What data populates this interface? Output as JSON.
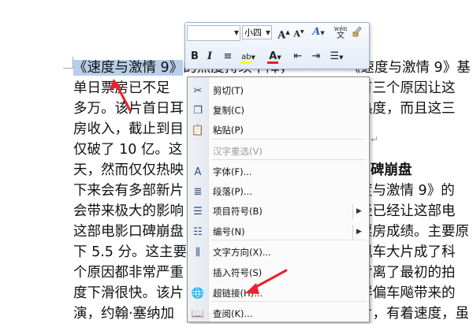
{
  "document": {
    "lines": [
      {
        "pre": "",
        "selected": "《速度与激情 9》",
        "post": "的热度持续下降，",
        "right": "《速度与激情 9》基"
      },
      {
        "pre": "单日票房已不足",
        "right": "有三个原因让这"
      },
      {
        "pre": "多万。该片首日耳",
        "right": "热度，而且这三"
      },
      {
        "pre": "房收入，截止到目",
        "right": ""
      },
      {
        "pre": "仅破了 10 亿。这",
        "right": ""
      },
      {
        "pre": "天，然而仅仅热映",
        "right": "碑崩盘"
      },
      {
        "pre": "下来会有多部新片",
        "right": "度与激情 9》的"
      },
      {
        "pre": "会带来极大的影响",
        "right": "经已经让这部电"
      },
      {
        "pre": "这部电影口碑崩盘",
        "right": "票房成绩。主要原"
      },
      {
        "pre": "下 5.5 分。这主要",
        "right": "飙车大片成了科"
      },
      {
        "pre": "个原因都非常严重",
        "right": "背离了最初的拍"
      },
      {
        "pre": "度下滑很快。该片",
        "right": "群偏车飚带来的"
      },
      {
        "pre": "演，约翰·塞纳加",
        "right": "片，有着速度，虽"
      }
    ]
  },
  "mini_toolbar": {
    "font_name": "",
    "font_size": "小四",
    "buttons": {
      "grow_font": "A",
      "shrink_font": "A",
      "format_painter_text": "A",
      "phonetic": "wén",
      "bold": "B",
      "italic": "I",
      "font_color": "A"
    }
  },
  "context_menu": {
    "items": [
      {
        "label": "剪切(T)",
        "icon": "scissors-icon",
        "glyph": "✂",
        "enabled": true
      },
      {
        "label": "复制(C)",
        "icon": "copy-icon",
        "glyph": "❐",
        "enabled": true
      },
      {
        "label": "粘贴(P)",
        "icon": "paste-icon",
        "glyph": "📋",
        "enabled": true
      },
      {
        "label": "汉字重选(V)",
        "icon": "",
        "glyph": "",
        "enabled": false
      },
      {
        "label": "字体(F)...",
        "icon": "font-icon",
        "glyph": "A",
        "enabled": true
      },
      {
        "label": "段落(P)...",
        "icon": "paragraph-icon",
        "glyph": "≣",
        "enabled": true
      },
      {
        "label": "项目符号(B)",
        "icon": "bullets-icon",
        "glyph": "☰",
        "enabled": true,
        "submenu": true
      },
      {
        "label": "编号(N)",
        "icon": "numbering-icon",
        "glyph": "☷",
        "enabled": true,
        "submenu": true
      },
      {
        "label": "文字方向(X)...",
        "icon": "text-direction-icon",
        "glyph": "⫼",
        "enabled": true
      },
      {
        "label": "插入符号(S)",
        "icon": "",
        "glyph": "",
        "enabled": true
      },
      {
        "label": "超链接(H)...",
        "icon": "hyperlink-icon",
        "glyph": "🌐",
        "enabled": true
      },
      {
        "label": "查阅(K)...",
        "icon": "lookup-icon",
        "glyph": "📖",
        "enabled": true
      }
    ]
  },
  "colors": {
    "selection": "#b7cfe9",
    "annotation_arrow": "#e8222c",
    "highlight_yellow": "#ffff00",
    "font_red": "#e2231a"
  }
}
